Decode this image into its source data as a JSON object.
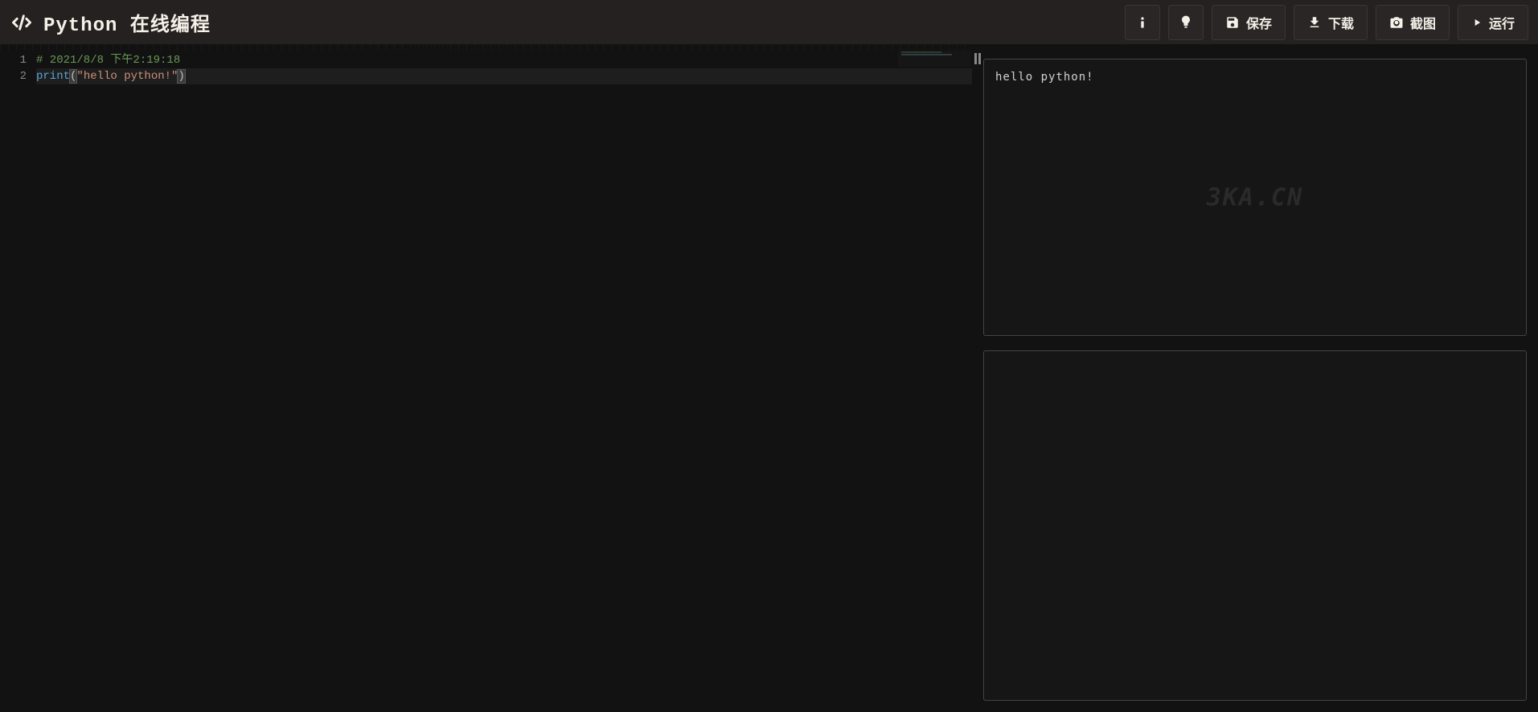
{
  "header": {
    "title": "Python 在线编程",
    "buttons": {
      "save": "保存",
      "download": "下载",
      "screenshot": "截图",
      "run": "运行"
    }
  },
  "editor": {
    "lines": [
      {
        "num": "1",
        "type": "comment",
        "content": "# 2021/8/8 下午2:19:18"
      },
      {
        "num": "2",
        "type": "code",
        "keyword": "print",
        "open": "(",
        "string": "\"hello python!\"",
        "close": ")"
      }
    ]
  },
  "output": {
    "text": "hello python!",
    "watermark": "3KA.CN"
  }
}
